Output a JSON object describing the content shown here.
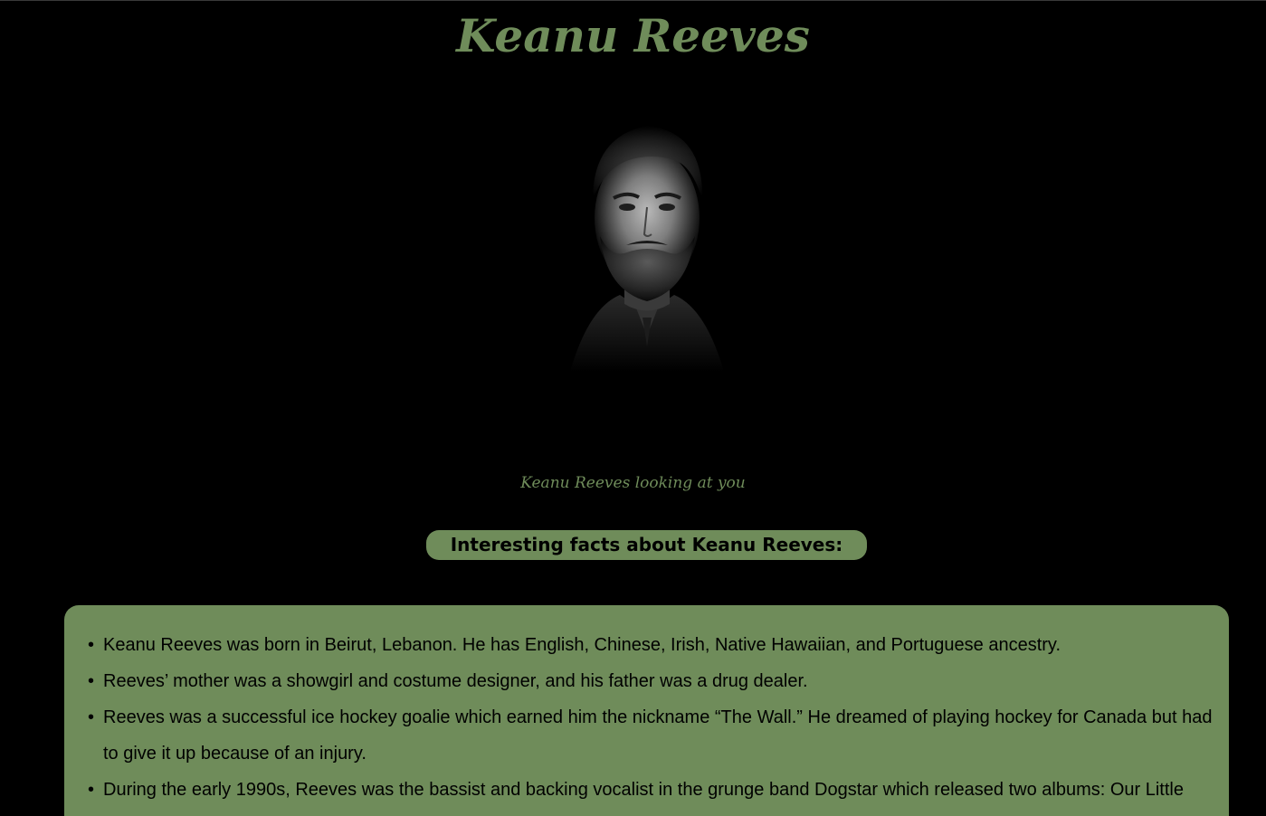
{
  "page": {
    "title": "Keanu Reeves"
  },
  "portrait": {
    "caption": "Keanu Reeves looking at you"
  },
  "facts": {
    "heading": "Interesting facts about Keanu Reeves:",
    "items": [
      "Keanu Reeves was born in Beirut, Lebanon. He has English, Chinese, Irish, Native Hawaiian, and Portuguese ancestry.",
      "Reeves’ mother was a showgirl and costume designer, and his father was a drug dealer.",
      "Reeves was a successful ice hockey goalie which earned him the nickname “The Wall.” He dreamed of playing hockey for Canada but had to give it up because of an injury.",
      "During the early 1990s, Reeves was the bassist and backing vocalist in the grunge band Dogstar which released two albums: Our Little"
    ]
  },
  "colors": {
    "background": "#000000",
    "accent_green": "#6f8c5a",
    "text_dark": "#000000"
  }
}
